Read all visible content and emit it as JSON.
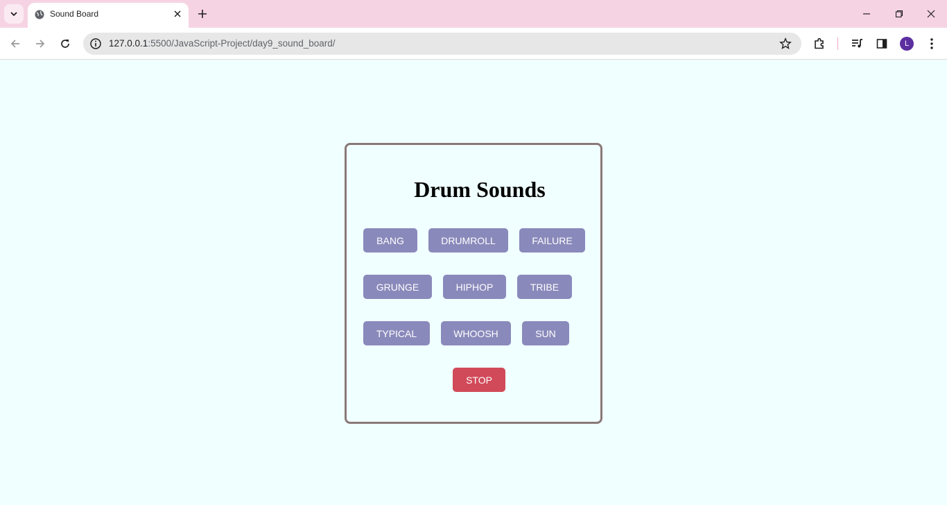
{
  "browser": {
    "tab_title": "Sound Board",
    "url_host": "127.0.0.1",
    "url_rest": ":5500/JavaScript-Project/day9_sound_board/",
    "avatar_letter": "L",
    "accent_color": "#f6d3e3"
  },
  "page": {
    "title": "Drum Sounds",
    "sound_buttons": [
      "BANG",
      "DRUMROLL",
      "FAILURE",
      "GRUNGE",
      "HIPHOP",
      "TRIBE",
      "TYPICAL",
      "WHOOSH",
      "SUN"
    ],
    "stop_label": "STOP",
    "colors": {
      "background": "#f0ffff",
      "button": "#8a89bb",
      "stop_button": "#d14a59",
      "card_border": "#8a7878"
    }
  }
}
